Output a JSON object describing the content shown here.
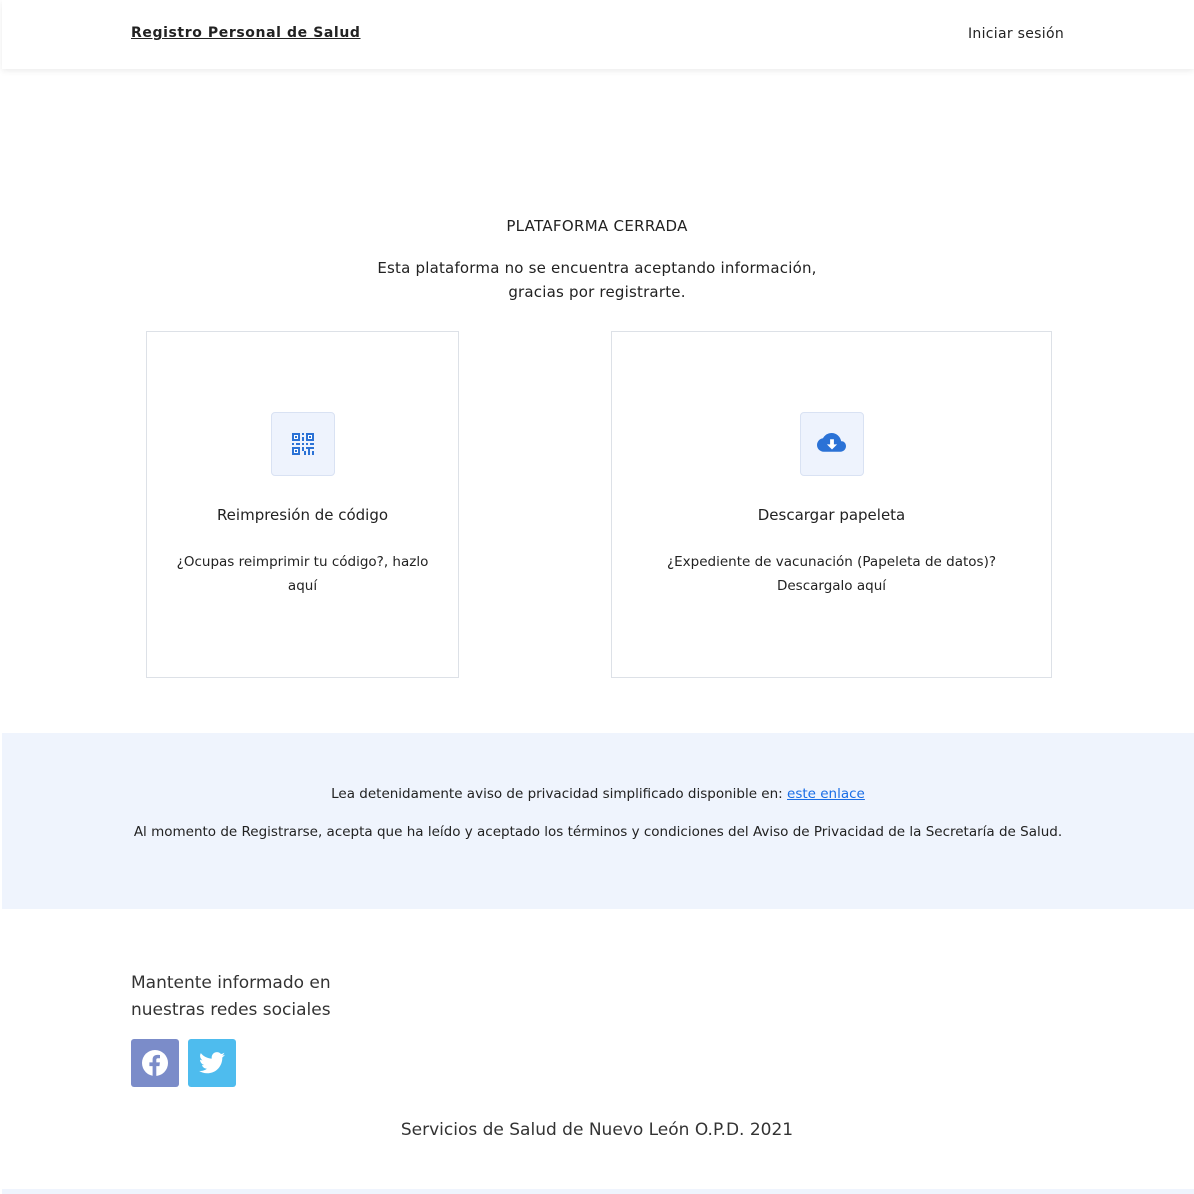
{
  "navbar": {
    "brand": "Registro Personal de Salud",
    "login": "Iniciar sesión"
  },
  "status": {
    "title": "PLATAFORMA CERRADA",
    "line1": "Esta plataforma no se encuentra aceptando información,",
    "line2": "gracias por registrarte."
  },
  "cards": [
    {
      "icon": "qr-code-icon",
      "title": "Reimpresión de código",
      "description": "¿Ocupas reimprimir tu código?, hazlo aquí"
    },
    {
      "icon": "cloud-download-icon",
      "title": "Descargar papeleta",
      "description": "¿Expediente de vacunación (Papeleta de datos)? Descargalo aquí"
    }
  ],
  "privacy": {
    "line1_prefix": "Lea detenidamente aviso de privacidad simplificado disponible en: ",
    "link_text": "este enlace",
    "line2": "Al momento de Registrarse, acepta que ha leído y aceptado los términos y condiciones del Aviso de Privacidad de la Secretaría de Salud."
  },
  "social": {
    "title": "Mantente informado en nuestras redes sociales",
    "buttons": [
      {
        "icon": "facebook-icon",
        "color": "#7b8cc9"
      },
      {
        "icon": "twitter-icon",
        "color": "#4ebcee"
      }
    ]
  },
  "footer": {
    "text": "Servicios de Salud de Nuevo León O.P.D. 2021"
  },
  "colors": {
    "accent": "#1a6ee6",
    "privacy_bg": "#eff4fd",
    "icon_blue": "#2b72d6"
  }
}
